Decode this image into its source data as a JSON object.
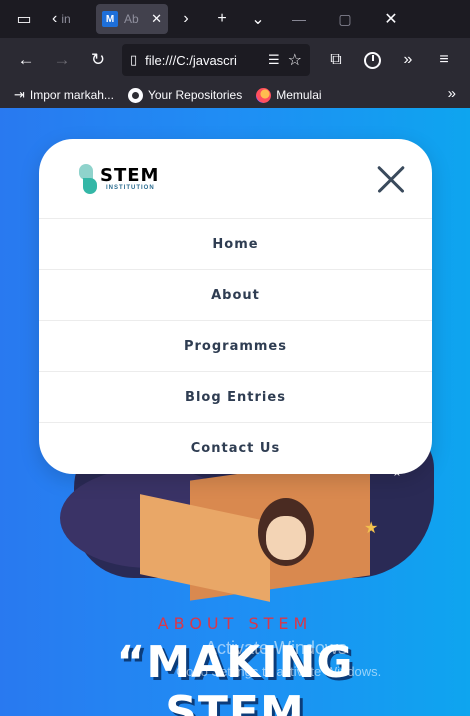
{
  "browser": {
    "inactive_tab_title": "in",
    "active_tab": {
      "favicon": "M",
      "title": "Ab"
    },
    "url": "file:///C:/javascri",
    "bookmarks": [
      {
        "label": "Impor markah...",
        "icon": "import-icon"
      },
      {
        "label": "Your Repositories",
        "icon": "github-icon"
      },
      {
        "label": "Memulai",
        "icon": "firefox-icon"
      }
    ]
  },
  "menu": {
    "logo": {
      "big": "STEM",
      "small": "INSTITUTION"
    },
    "items": [
      {
        "label": "Home"
      },
      {
        "label": "About"
      },
      {
        "label": "Programmes"
      },
      {
        "label": "Blog Entries"
      },
      {
        "label": "Contact Us"
      }
    ]
  },
  "hero": {
    "eyebrow": "ABOUT STEM",
    "title_line1": "“MAKING",
    "title_line2": "STEM"
  },
  "watermark": {
    "line1": "Activate Windows",
    "line2": "Go to Settings to activate Windows."
  },
  "colors": {
    "page_gradient_start": "#2979f0",
    "page_gradient_end": "#0ea5ef",
    "eyebrow": "#d9374a",
    "logo_accent": "#34b7a7"
  }
}
